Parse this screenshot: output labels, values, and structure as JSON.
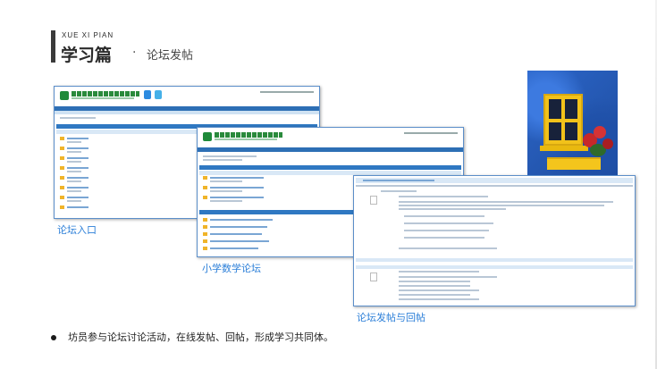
{
  "header": {
    "subtitle": "XUE XI PIAN",
    "title": "学习篇",
    "separator": "·",
    "section": "论坛发帖"
  },
  "captions": {
    "forum_entry": "论坛入口",
    "math_forum": "小学数学论坛",
    "post_reply": "论坛发帖与回帖"
  },
  "bullet": {
    "text": "坊员参与论坛讨论活动，在线发帖、回帖，形成学习共同体。"
  },
  "colors": {
    "accent_blue": "#2c7fd8",
    "title_dark": "#2b2b2b",
    "site_green": "#1f8a3a",
    "site_nav_blue": "#2d6fb5"
  }
}
